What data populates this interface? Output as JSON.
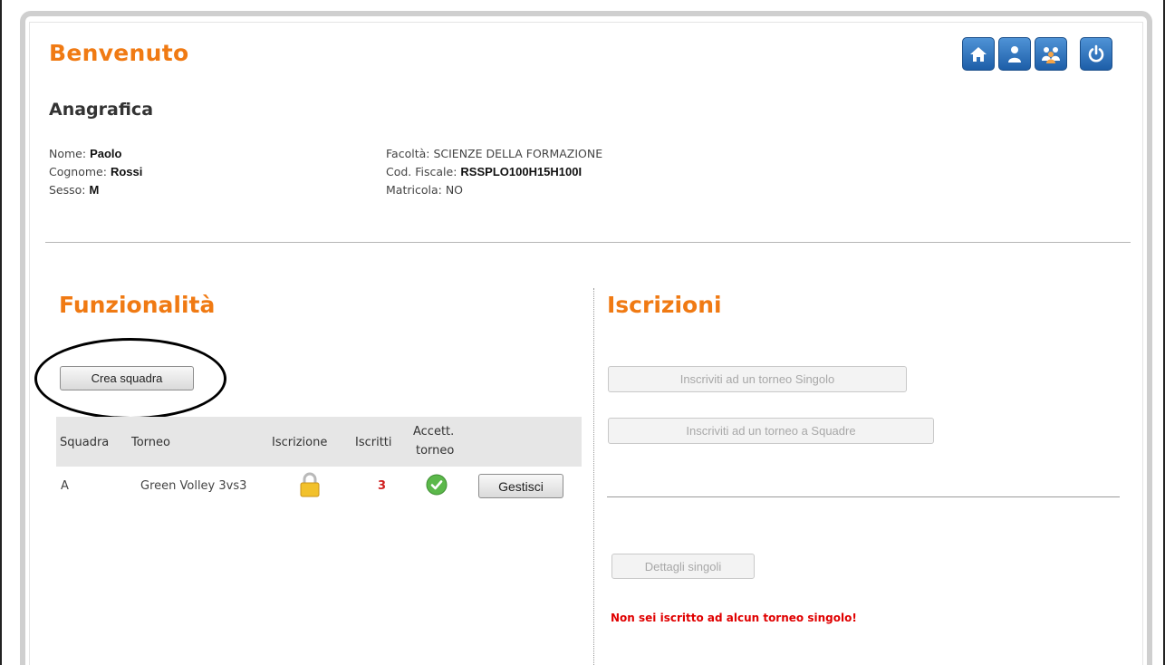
{
  "header": {
    "title": "Benvenuto",
    "icons": [
      "home-icon",
      "user-icon",
      "group-icon",
      "power-icon"
    ]
  },
  "anagrafica": {
    "heading": "Anagrafica",
    "left": [
      {
        "label": "Nome:",
        "value": "Paolo"
      },
      {
        "label": "Cognome:",
        "value": "Rossi"
      },
      {
        "label": "Sesso:",
        "value": "M"
      }
    ],
    "right": [
      {
        "label": "Facoltà:",
        "value": "SCIENZE DELLA FORMAZIONE"
      },
      {
        "label": "Cod. Fiscale:",
        "value": "RSSPLO100H15H100I"
      },
      {
        "label": "Matricola:",
        "value": "NO"
      }
    ]
  },
  "funzionalita": {
    "heading": "Funzionalità",
    "create_button": "Crea squadra",
    "table": {
      "headers": [
        "Squadra",
        "Torneo",
        "Iscrizione",
        "Iscritti",
        "Accett.",
        "torneo"
      ],
      "row": {
        "squadra": "A",
        "torneo": "Green Volley 3vs3",
        "iscritti": "3",
        "action": "Gestisci"
      }
    }
  },
  "iscrizioni": {
    "heading": "Iscrizioni",
    "btn_singolo": "Inscriviti ad un torneo Singolo",
    "btn_squadre": "Inscriviti ad un torneo a Squadre",
    "btn_dettagli": "Dettagli singoli",
    "error": "Non sei iscritto ad alcun torneo singolo!"
  },
  "colors": {
    "accent": "#f07a13",
    "error": "#e00000",
    "icon_blue": "#2a6db8"
  }
}
